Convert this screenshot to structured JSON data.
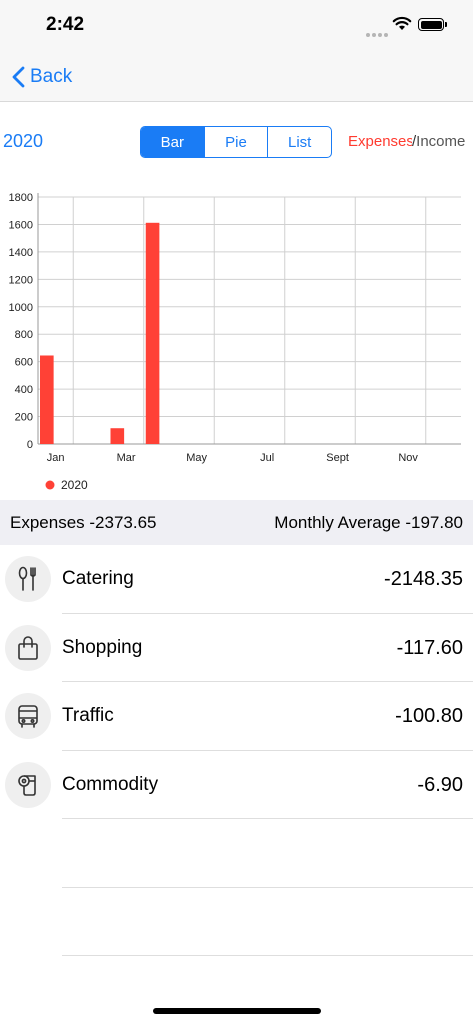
{
  "status": {
    "time": "2:42"
  },
  "nav": {
    "back_label": "Back"
  },
  "controls": {
    "year": "2020",
    "segments": [
      "Bar",
      "Pie",
      "List"
    ],
    "selected_segment": "Bar",
    "type_expenses": "Expenses",
    "type_separator": "/",
    "type_income": "Income"
  },
  "chart_data": {
    "type": "bar",
    "x_tick_labels": [
      "Jan",
      "Mar",
      "May",
      "Jul",
      "Sept",
      "Nov"
    ],
    "months": [
      1,
      2,
      3,
      4,
      5,
      6,
      7,
      8,
      9,
      10,
      11,
      12
    ],
    "series": [
      {
        "name": "2020",
        "color": "#ff4136",
        "values": [
          645,
          0,
          0,
          0,
          115,
          0,
          1612,
          0,
          0,
          0,
          0,
          0,
          0,
          0,
          0,
          0,
          0,
          0,
          0,
          0,
          0,
          0,
          0,
          0
        ]
      }
    ],
    "y_ticks": [
      0,
      200,
      400,
      600,
      800,
      1000,
      1200,
      1400,
      1600,
      1800
    ],
    "ylim": [
      0,
      1800
    ],
    "grid": true,
    "legend": "bottom-left"
  },
  "summary": {
    "expenses": "Expenses -2373.65",
    "monthly_average": "Monthly Average -197.80"
  },
  "categories": [
    {
      "label": "Catering",
      "value": "-2148.35",
      "icon": "fork-spoon-icon"
    },
    {
      "label": "Shopping",
      "value": "-117.60",
      "icon": "shopping-bag-icon"
    },
    {
      "label": "Traffic",
      "value": "-100.80",
      "icon": "bus-icon"
    },
    {
      "label": "Commodity",
      "value": "-6.90",
      "icon": "toilet-paper-icon"
    }
  ]
}
